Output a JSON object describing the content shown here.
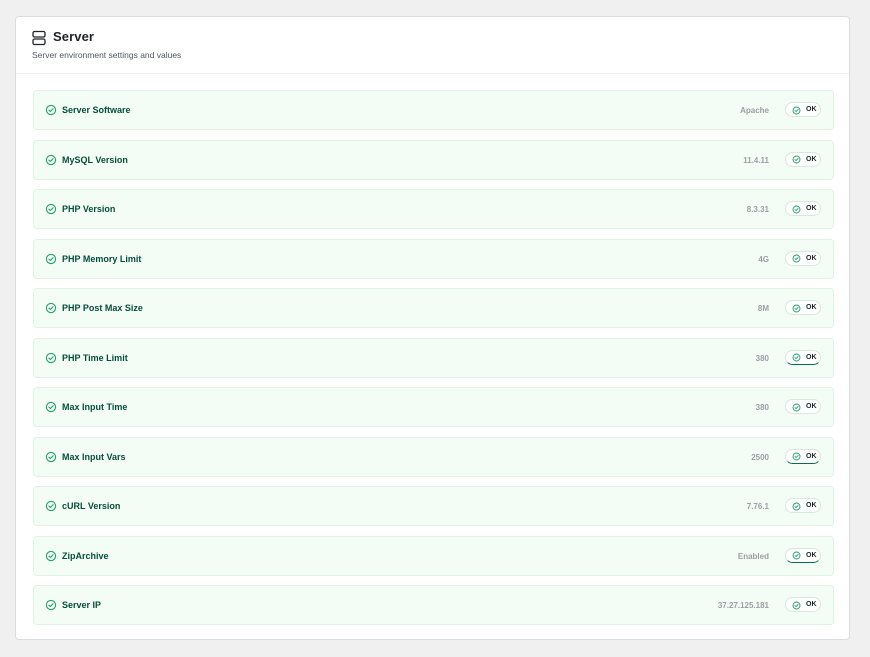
{
  "panel": {
    "title": "Server",
    "subtitle": "Server environment settings and values",
    "icon": "server-icon"
  },
  "checks": [
    {
      "label": "Server Software",
      "value": "Apache",
      "status": "OK",
      "icon": "check-circle-icon"
    },
    {
      "label": "MySQL Version",
      "value": "11.4.11",
      "status": "OK",
      "icon": "check-circle-icon"
    },
    {
      "label": "PHP Version",
      "value": "8.3.31",
      "status": "OK",
      "icon": "check-circle-icon"
    },
    {
      "label": "PHP Memory Limit",
      "value": "4G",
      "status": "OK",
      "icon": "check-circle-icon"
    },
    {
      "label": "PHP Post Max Size",
      "value": "8M",
      "status": "OK",
      "icon": "check-circle-icon"
    },
    {
      "label": "PHP Time Limit",
      "value": "380",
      "status": "OK",
      "icon": "check-circle-icon"
    },
    {
      "label": "Max Input Time",
      "value": "380",
      "status": "OK",
      "icon": "check-circle-icon"
    },
    {
      "label": "Max Input Vars",
      "value": "2500",
      "status": "OK",
      "icon": "check-circle-icon"
    },
    {
      "label": "cURL Version",
      "value": "7.76.1",
      "status": "OK",
      "icon": "check-circle-icon"
    },
    {
      "label": "ZipArchive",
      "value": "Enabled",
      "status": "OK",
      "icon": "check-circle-icon"
    },
    {
      "label": "Server IP",
      "value": "37.27.125.181",
      "status": "OK",
      "icon": "check-circle-icon"
    }
  ],
  "colors": {
    "row_bg": "#f3fdf6",
    "row_border": "#dff3e5",
    "label": "#064e3b",
    "check_icon": "#22a06b",
    "value": "#9aa0a6"
  }
}
